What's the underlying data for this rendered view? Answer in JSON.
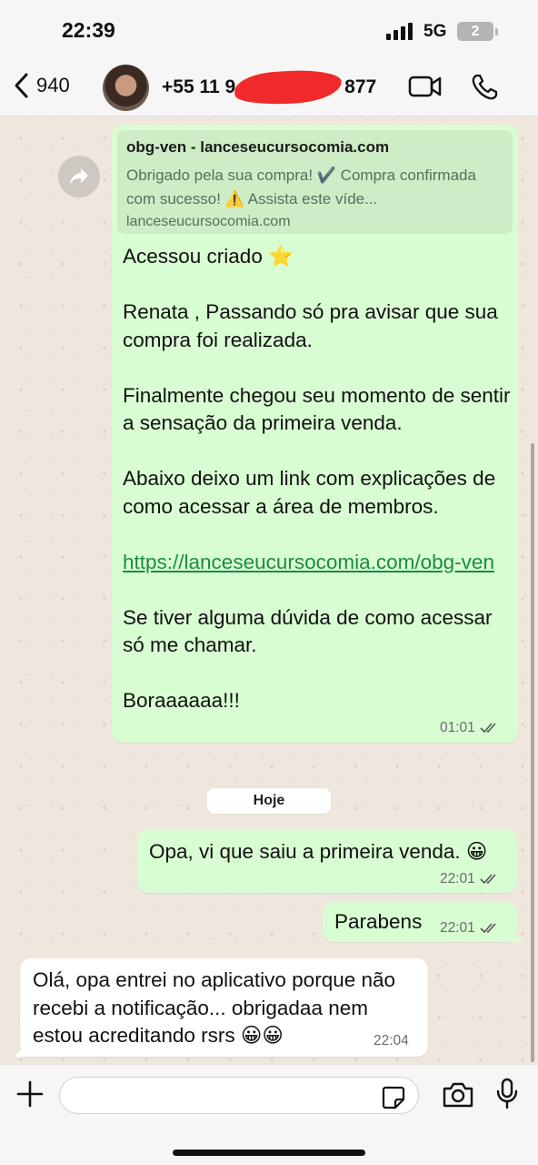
{
  "status_bar": {
    "time": "22:39",
    "network": "5G",
    "battery": "2"
  },
  "header": {
    "back_count": "940",
    "contact_name": "+55 11 9",
    "contact_name_tail": "877"
  },
  "messages": {
    "forwarded_message": {
      "link_preview": {
        "title": "obg-ven - lanceseucursocomia.com",
        "description": "Obrigado pela sua compra! ✔️ Compra confirmada com sucesso! ⚠️ Assista este víde...",
        "domain": "lanceseucursocomia.com"
      },
      "paragraphs": [
        "Acessou criado ⭐",
        "Renata , Passando só pra avisar que sua compra foi realizada.",
        "Finalmente chegou seu momento de sentir a sensação da primeira venda.",
        "Abaixo deixo um link com explicações de como acessar a área de membros."
      ],
      "link": "https://lanceseucursocomia.com/obg-ven",
      "paragraphs_after": [
        "Se tiver alguma dúvida de como acessar só me chamar.",
        "Boraaaaaa!!!"
      ],
      "time": "01:01"
    },
    "date_separator": "Hoje",
    "outgoing_1": {
      "text": "Opa, vi que saiu a primeira venda. 😀",
      "time": "22:01"
    },
    "outgoing_2": {
      "text": "Parabens",
      "time": "22:01"
    },
    "incoming_1": {
      "text": "Olá, opa entrei no aplicativo porque não recebi a notificação... obrigadaa nem estou acreditando rsrs 😀😀",
      "time": "22:04"
    }
  },
  "input_bar": {
    "placeholder": ""
  },
  "colors": {
    "outgoing_bubble": "#d9fdd3",
    "incoming_bubble": "#ffffff",
    "link": "#1b8a4a",
    "chat_background": "#efe7de"
  },
  "icons": [
    "back-chevron-icon",
    "video-call-icon",
    "phone-icon",
    "forward-icon",
    "read-receipt-icon",
    "plus-icon",
    "sticker-icon",
    "camera-icon",
    "microphone-icon"
  ]
}
